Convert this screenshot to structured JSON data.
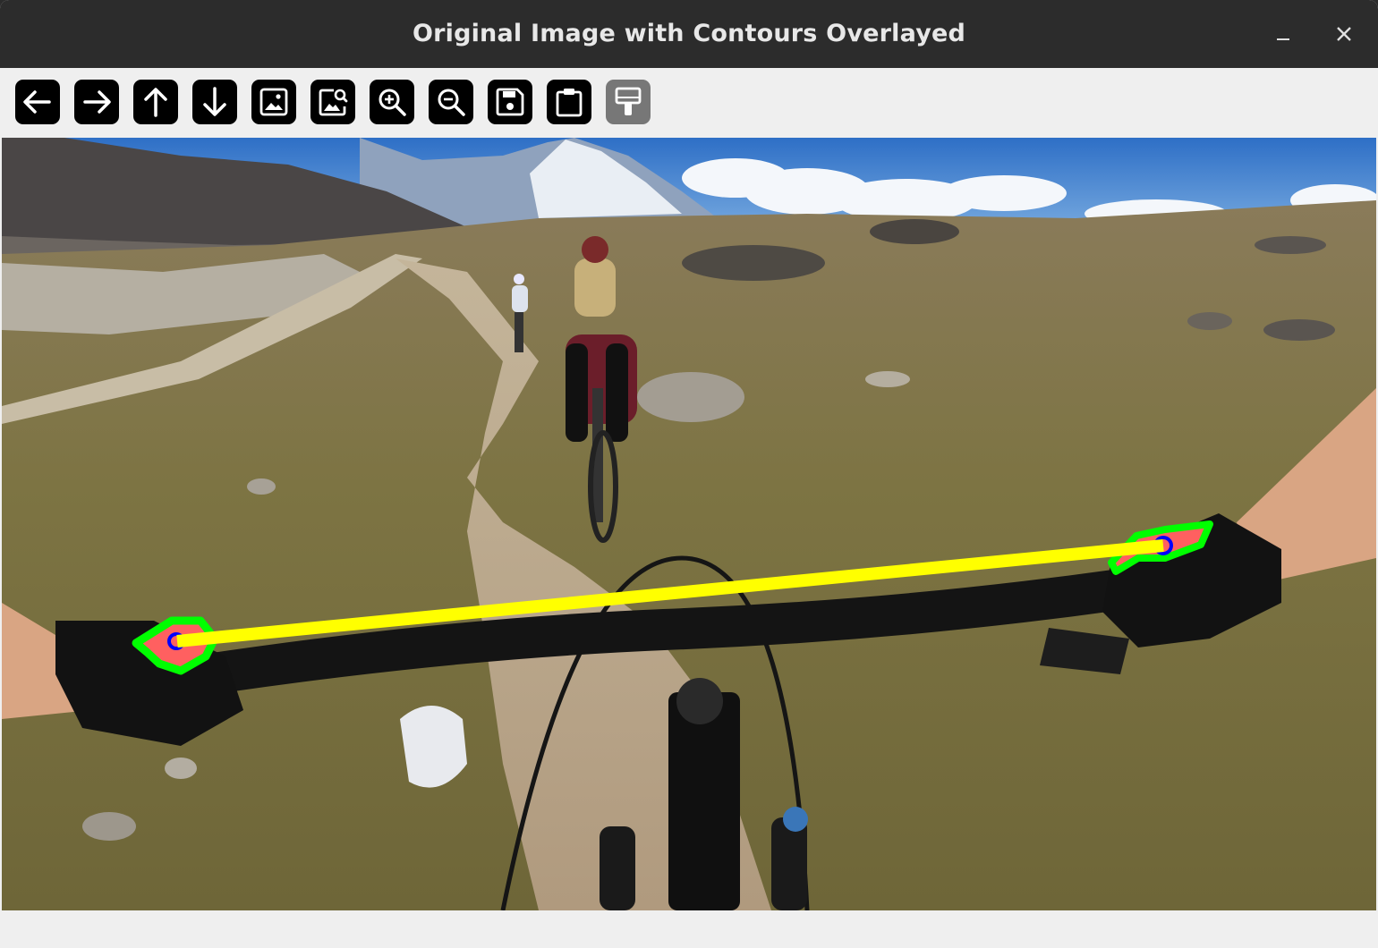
{
  "window": {
    "title": "Original Image with Contours Overlayed",
    "controls": [
      "minimize-icon",
      "close-icon"
    ]
  },
  "toolbar": {
    "tools": [
      {
        "name": "back",
        "icon": "arrow-left-icon"
      },
      {
        "name": "forward",
        "icon": "arrow-right-icon"
      },
      {
        "name": "up",
        "icon": "arrow-up-icon"
      },
      {
        "name": "down",
        "icon": "arrow-down-icon"
      },
      {
        "name": "fit-image",
        "icon": "image-icon"
      },
      {
        "name": "image-inspect",
        "icon": "image-search-icon"
      },
      {
        "name": "zoom-in",
        "icon": "zoom-in-icon"
      },
      {
        "name": "zoom-out",
        "icon": "zoom-out-icon"
      },
      {
        "name": "save",
        "icon": "save-icon"
      },
      {
        "name": "copy-to-clipboard",
        "icon": "clipboard-icon"
      },
      {
        "name": "properties",
        "icon": "paint-brush-icon",
        "disabled": true
      }
    ]
  },
  "image": {
    "subject": "first-person mountain bike view on alpine trail",
    "overlay": {
      "contour_color": "#00ff00",
      "fill_color": "#ff6060",
      "center_marker_color": "#0000ff",
      "connecting_line_color": "#ffff00"
    }
  },
  "colors": {
    "titlebar": "#2c2c2c",
    "toolbar": "#efefef",
    "tool_button": "#000000",
    "tool_button_disabled": "#777777"
  }
}
